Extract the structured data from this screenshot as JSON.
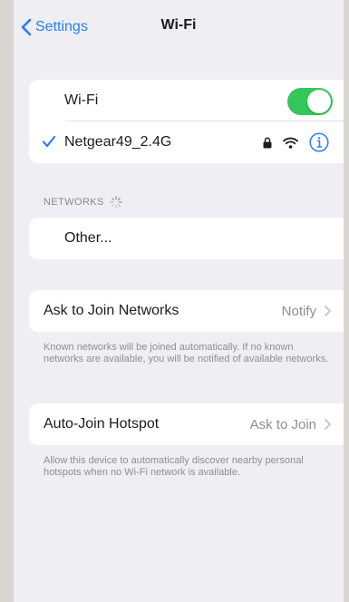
{
  "nav": {
    "back_label": "Settings",
    "title": "Wi-Fi"
  },
  "wifi": {
    "toggle_label": "Wi-Fi",
    "toggle_on": true,
    "connected_network": "Netgear49_2.4G"
  },
  "networks": {
    "header": "NETWORKS",
    "other_label": "Other..."
  },
  "ask_to_join": {
    "label": "Ask to Join Networks",
    "value": "Notify",
    "footnote": "Known networks will be joined automatically. If no known networks are available, you will be notified of available networks."
  },
  "auto_join": {
    "label": "Auto-Join Hotspot",
    "value": "Ask to Join",
    "footnote": "Allow this device to automatically discover nearby personal hotspots when no Wi-Fi network is available."
  },
  "colors": {
    "accent": "#2a7cf6",
    "toggle_on": "#34c759",
    "background": "#efeef3",
    "secondary_text": "#8e8e93"
  },
  "icons": {
    "back": "chevron-left-icon",
    "connected": "checkmark-icon",
    "lock": "lock-icon",
    "wifi": "wifi-signal-icon",
    "info": "info-icon",
    "loading": "spinner-icon",
    "disclosure": "chevron-right-icon"
  }
}
